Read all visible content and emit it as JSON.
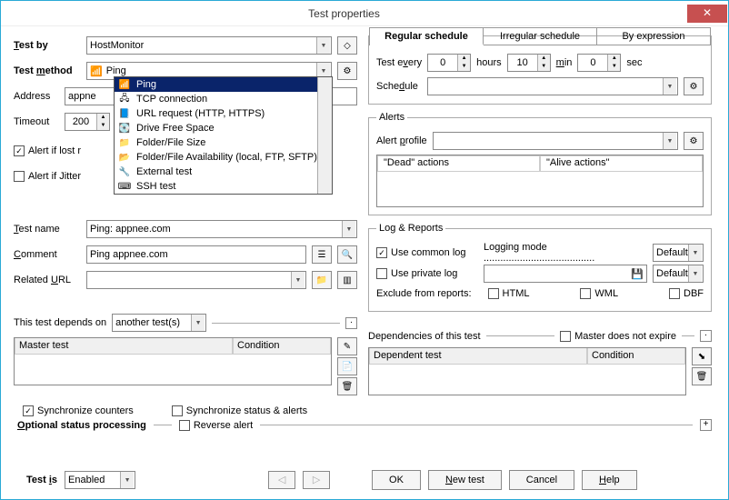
{
  "window": {
    "title": "Test properties"
  },
  "left": {
    "test_by_label": "Test by",
    "test_by_value": "HostMonitor",
    "test_method_label": "Test method",
    "test_method_value": "Ping",
    "address_label": "Address",
    "address_value": "appne",
    "timeout_label": "Timeout",
    "timeout_value": "200",
    "alert_lost_label": "Alert if lost r",
    "alert_jitter_label": "Alert if Jitter",
    "test_name_label": "Test name",
    "test_name_value": "Ping: appnee.com",
    "comment_label": "Comment",
    "comment_value": "Ping appnee.com",
    "related_url_label": "Related URL",
    "related_url_value": "",
    "depends_label": "This test depends on",
    "depends_value": "another test(s)",
    "col_master": "Master test",
    "col_condition": "Condition",
    "sync_counters": "Synchronize counters",
    "sync_status": "Synchronize status & alerts",
    "opt_status": "Optional status processing",
    "reverse_alert": "Reverse alert"
  },
  "dropdown": {
    "items": [
      "Ping",
      "TCP connection",
      "URL request (HTTP, HTTPS)",
      "Drive Free Space",
      "Folder/File Size",
      "Folder/File Availability (local, FTP, SFTP)",
      "External test",
      "SSH test"
    ]
  },
  "right": {
    "tab_regular": "Regular schedule",
    "tab_irregular": "Irregular schedule",
    "tab_expression": "By expression",
    "test_every_label": "Test every",
    "hours_val": "0",
    "hours_label": "hours",
    "min_val": "10",
    "min_label": "min",
    "sec_val": "0",
    "sec_label": "sec",
    "schedule_label": "Schedule",
    "schedule_value": "",
    "alerts_title": "Alerts",
    "alert_profile_label": "Alert profile",
    "alert_profile_value": "",
    "dead_actions": "\"Dead\" actions",
    "alive_actions": "\"Alive actions\"",
    "log_title": "Log & Reports",
    "use_common": "Use common log",
    "logging_mode": "Logging mode ........................................",
    "default1": "Default",
    "use_private": "Use private log",
    "private_val": "",
    "default2": "Default",
    "exclude_label": "Exclude from reports:",
    "html": "HTML",
    "wml": "WML",
    "dbf": "DBF",
    "deps_title": "Dependencies of this test",
    "master_expire": "Master does not expire",
    "col_dep": "Dependent test",
    "col_cond": "Condition"
  },
  "footer": {
    "test_is": "Test is",
    "test_is_value": "Enabled",
    "ok": "OK",
    "new_test": "New test",
    "cancel": "Cancel",
    "help": "Help"
  }
}
